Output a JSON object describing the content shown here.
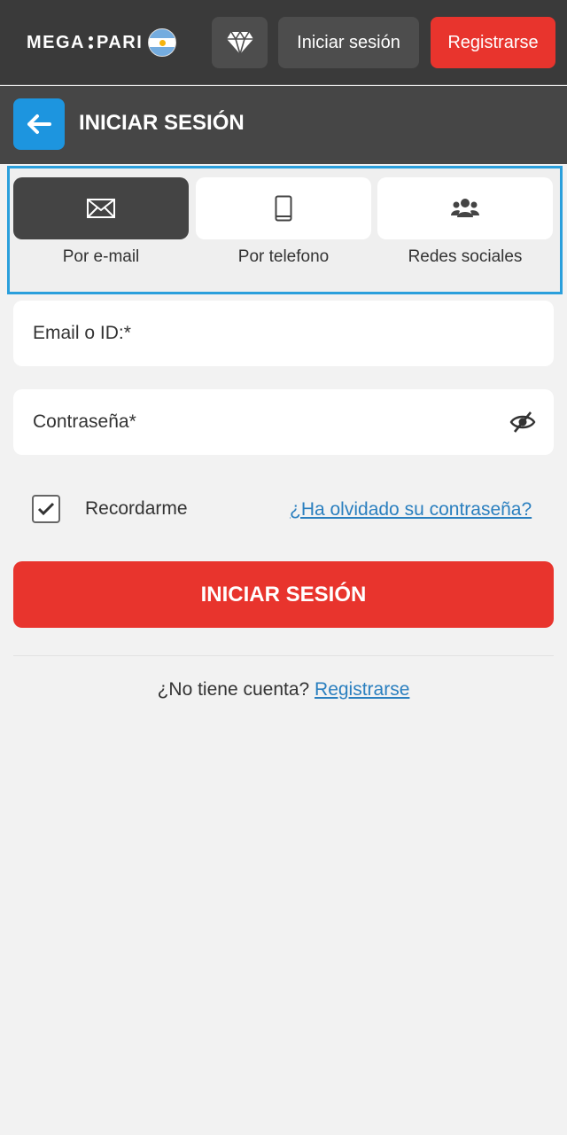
{
  "header": {
    "logo_left": "MEGA",
    "logo_right": "PARI",
    "login_label": "Iniciar sesión",
    "register_label": "Registrarse"
  },
  "subheader": {
    "title": "INICIAR SESIÓN"
  },
  "tabs": [
    {
      "label": "Por e-mail",
      "icon": "envelope-icon",
      "active": true
    },
    {
      "label": "Por telefono",
      "icon": "phone-icon",
      "active": false
    },
    {
      "label": "Redes sociales",
      "icon": "users-icon",
      "active": false
    }
  ],
  "form": {
    "email_placeholder": "Email o ID:*",
    "password_placeholder": "Contraseña*",
    "remember_label": "Recordarme",
    "remember_checked": true,
    "forgot_label": "¿Ha olvidado su contraseña?",
    "submit_label": "INICIAR SESIÓN"
  },
  "footer": {
    "no_account_text": "¿No tiene cuenta?",
    "register_link": "Registrarse"
  },
  "colors": {
    "accent_red": "#e8342d",
    "accent_blue": "#1d95df",
    "link_blue": "#2a7fbf",
    "header_bg": "#3a3a3a"
  }
}
